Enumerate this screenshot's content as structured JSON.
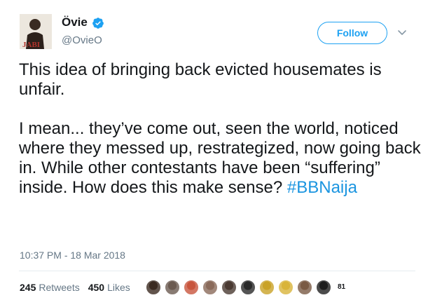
{
  "author": {
    "display_name": "Övie",
    "handle": "@OvieO",
    "verified": true,
    "avatar_text": "JABI"
  },
  "follow_label": "Follow",
  "tweet": {
    "paragraph_1": "This idea of bringing back evicted housemates is unfair.",
    "paragraph_2": "I mean... they’ve come out, seen the world, noticed where they messed up, restrategized, now going back in. While other contestants have been “suffering” inside. How does this make sense?",
    "hashtag": "#BBNaija"
  },
  "timestamp": "10:37 PM - 18 Mar 2018",
  "stats": {
    "retweets_count": "245",
    "retweets_label": "Retweets",
    "likes_count": "450",
    "likes_label": "Likes"
  },
  "likers": {
    "count_label": "81",
    "colors": [
      "#3a2a20",
      "#6b5a50",
      "#c8553d",
      "#8a6a5a",
      "#4a3a32",
      "#2a2a2a",
      "#c9a227",
      "#d9b43a",
      "#7a5a44",
      "#1e1e1e"
    ]
  },
  "colors": {
    "accent": "#1da1f2",
    "hashtag": "#1b95e0",
    "secondary_text": "#657786",
    "verified_badge": "#1da1f2"
  }
}
